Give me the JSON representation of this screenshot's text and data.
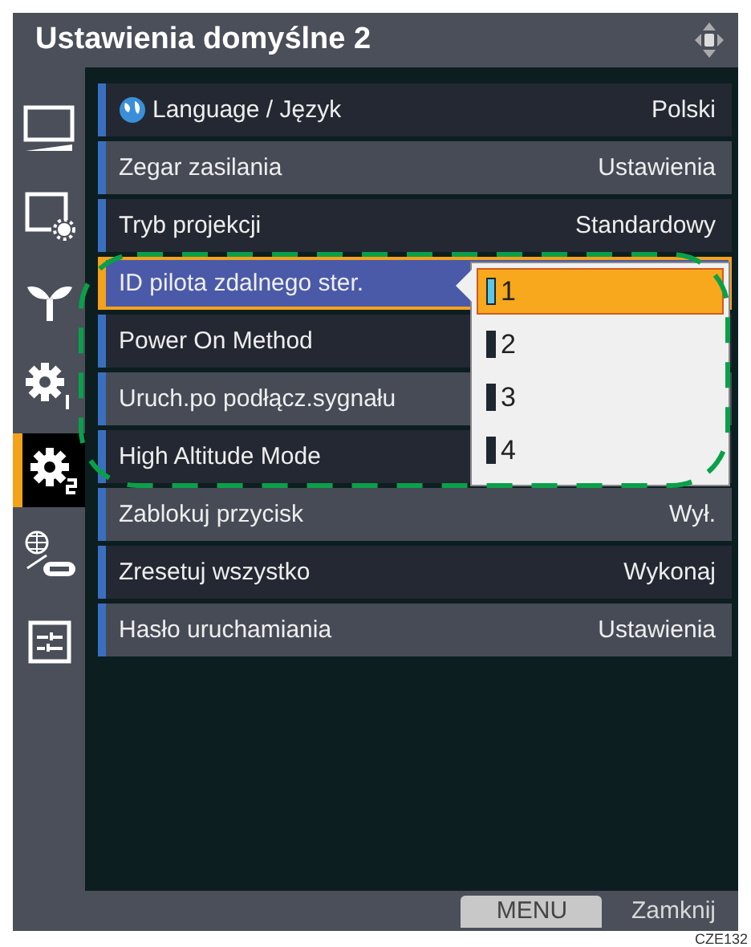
{
  "window": {
    "title": "Ustawienia domyślne 2"
  },
  "sidebar": {
    "items": [
      {
        "selected": false
      },
      {
        "selected": false
      },
      {
        "selected": false
      },
      {
        "selected": false
      },
      {
        "selected": true
      },
      {
        "selected": false
      },
      {
        "selected": false
      }
    ]
  },
  "menu": {
    "rows": [
      {
        "label": "Language / Język",
        "value": "Polski",
        "selected": false
      },
      {
        "label": "Zegar zasilania",
        "value": "Ustawienia",
        "selected": false
      },
      {
        "label": "Tryb projekcji",
        "value": "Standardowy",
        "selected": false
      },
      {
        "label": "ID pilota zdalnego ster.",
        "selected": true
      },
      {
        "label": "Power On Method",
        "selected": false
      },
      {
        "label": "Uruch.po podłącz.sygnału",
        "selected": false
      },
      {
        "label": "High Altitude Mode",
        "selected": false
      },
      {
        "label": "Zablokuj przycisk",
        "value": "Wył.",
        "selected": false
      },
      {
        "label": "Zresetuj wszystko",
        "value": "Wykonaj",
        "selected": false
      },
      {
        "label": "Hasło uruchamiania",
        "value": "Ustawienia",
        "selected": false
      }
    ]
  },
  "dropdown": {
    "options": [
      {
        "label": "1",
        "selected": true
      },
      {
        "label": "2",
        "selected": false
      },
      {
        "label": "3",
        "selected": false
      },
      {
        "label": "4",
        "selected": false
      }
    ]
  },
  "footer": {
    "buttons": [
      {
        "label": "MENU",
        "kind": "key"
      },
      {
        "label": "Zamknij",
        "kind": "text"
      }
    ]
  },
  "caption": "CZE132"
}
